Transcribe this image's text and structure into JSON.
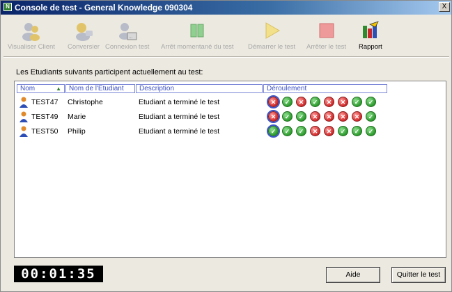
{
  "window": {
    "title": "Console de test - General Knowledge 090304",
    "close_glyph": "X"
  },
  "toolbar": {
    "items": [
      {
        "label": "Visualiser Client",
        "icon": "users-icon",
        "enabled": false
      },
      {
        "label": "Conversier",
        "icon": "chat-icon",
        "enabled": false
      },
      {
        "label": "Connexion test",
        "icon": "connect-icon",
        "enabled": false
      },
      {
        "label": "Arrêt momentané du test",
        "icon": "pause-icon",
        "enabled": false
      },
      {
        "label": "Démarrer le test",
        "icon": "play-icon",
        "enabled": false
      },
      {
        "label": "Arrêter le test",
        "icon": "stop-icon",
        "enabled": false
      },
      {
        "label": "Rapport",
        "icon": "report-icon",
        "enabled": true
      }
    ]
  },
  "info_label": "Les Etudiants suivants participent actuellement au test:",
  "list": {
    "columns": [
      "Nom",
      "Nom de l'Etudiant",
      "Description",
      "Déroulement"
    ],
    "rows": [
      {
        "id": "TEST47",
        "name": "Christophe",
        "description": "Etudiant a terminé le test",
        "progress": [
          "ko",
          "ok",
          "ko",
          "ok",
          "ko",
          "ko",
          "ok",
          "ok"
        ]
      },
      {
        "id": "TEST49",
        "name": "Marie",
        "description": "Etudiant a terminé le test",
        "progress": [
          "ko",
          "ok",
          "ok",
          "ko",
          "ko",
          "ko",
          "ko",
          "ok"
        ]
      },
      {
        "id": "TEST50",
        "name": "Philip",
        "description": "Etudiant a terminé le test",
        "progress": [
          "ok",
          "ok",
          "ok",
          "ko",
          "ko",
          "ok",
          "ok",
          "ok"
        ]
      }
    ]
  },
  "timer": "00:01:35",
  "buttons": {
    "help": "Aide",
    "quit": "Quitter le test"
  },
  "colors": {
    "ok": "#2c9a2c",
    "ko": "#cf2a2a",
    "header_text": "#3b4fc2"
  }
}
